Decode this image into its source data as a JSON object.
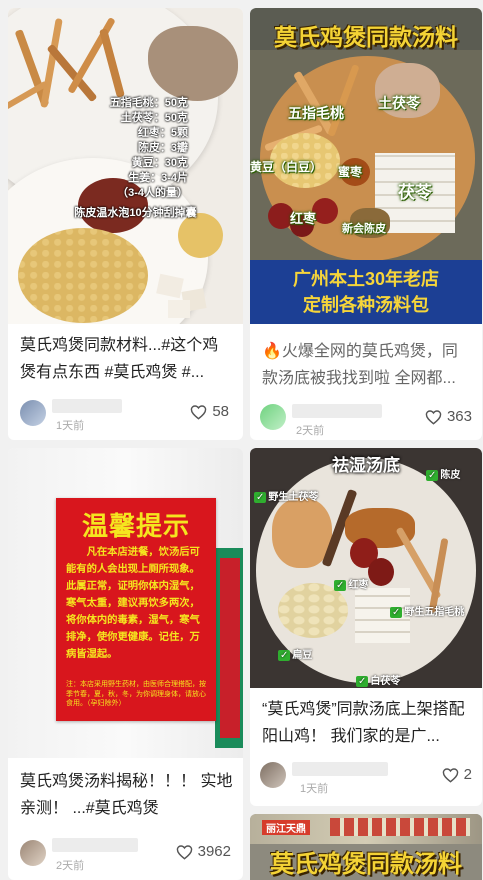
{
  "cards": [
    {
      "title": "莫氏鸡煲同款材料...#这个鸡煲有点东西 #莫氏鸡煲 #...",
      "time": "1天前",
      "likes": "58",
      "image_text": [
        "五指毛桃：50克",
        "土茯苓：50克",
        "红枣：5颗",
        "陈皮：3瓣",
        "黄豆：30克",
        "生姜：3-4片",
        "（3-4人的量）",
        "陈皮温水泡10分钟刮掉囊"
      ]
    },
    {
      "title": "🔥火爆全网的莫氏鸡煲，同款汤底被我找到啦 全网都...",
      "time": "2天前",
      "likes": "363",
      "image_header": "莫氏鸡煲同款汤料",
      "image_labels": [
        "五指毛桃",
        "土茯苓",
        "黄豆（白豆）",
        "蜜枣",
        "茯苓",
        "红枣",
        "新会陈皮"
      ],
      "image_footer": [
        "广州本土30年老店",
        "定制各种汤料包"
      ]
    },
    {
      "title": "莫氏鸡煲汤料揭秘！！！ 实地亲测！ ...#莫氏鸡煲",
      "time": "2天前",
      "likes": "3962",
      "sign_title": "温馨提示",
      "sign_body": "凡在本店进餐，饮汤后可能有的人会出现上厕所现象。此属正常，证明你体内湿气，寒气太重，建议再饮多两次，将你体内的毒素，湿气，寒气排净，使你更健康。记住，万病皆湿起。",
      "sign_note": "注：本店采用野生药材，由医师合理搭配，按季节春，夏，秋，冬，为你调理身体，请放心食用。（孕妇除外）"
    },
    {
      "title": "“莫氏鸡煲”同款汤底上架搭配阳山鸡！ 我们家的是广...",
      "time": "1天前",
      "likes": "2",
      "image_header": "祛湿汤底",
      "image_labels": [
        "陈皮",
        "野生土茯苓",
        "红枣",
        "野生五指毛桃",
        "扁豆",
        "白茯苓"
      ]
    },
    {
      "image_header": "莫氏鸡煲同款汤料",
      "image_sign": "丽江天鼎"
    }
  ],
  "colors": {
    "red_sign": "#d8161d",
    "sign_text": "#f5e51f"
  },
  "icons": [
    "heart-icon",
    "fire-icon",
    "check-icon"
  ]
}
